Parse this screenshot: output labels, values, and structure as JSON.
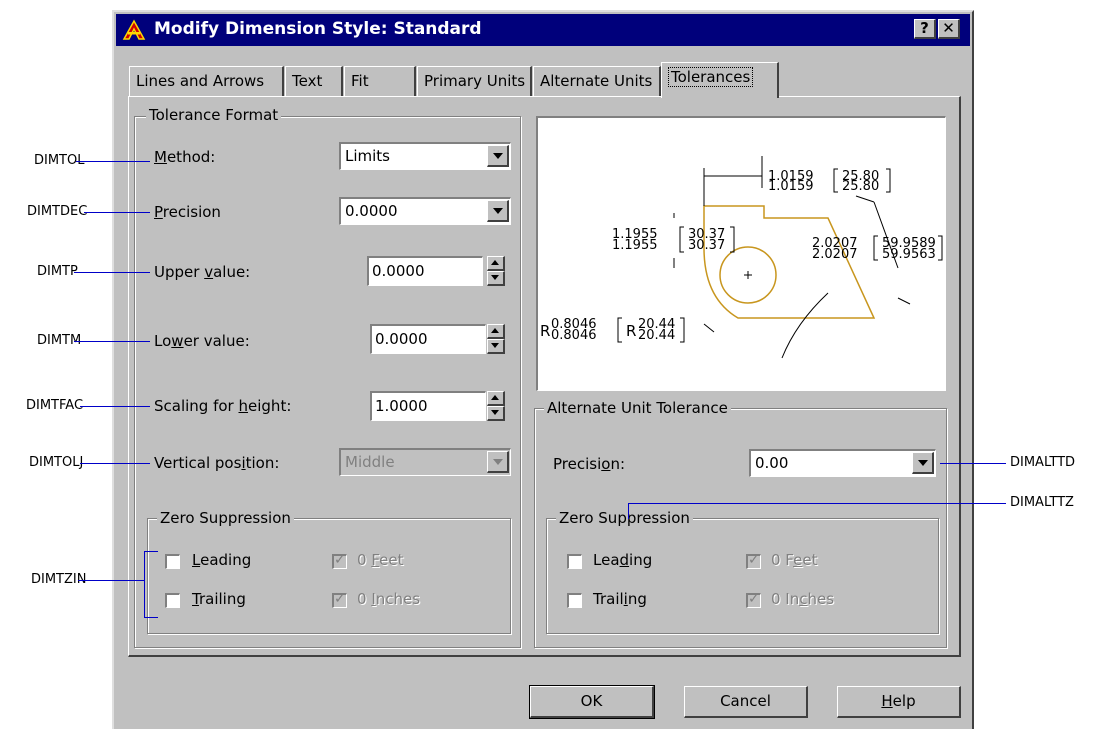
{
  "window": {
    "title": "Modify Dimension Style: Standard",
    "help_btn": "?",
    "close_btn": "✕"
  },
  "tabs": [
    "Lines and Arrows",
    "Text",
    "Fit",
    "Primary Units",
    "Alternate Units",
    "Tolerances"
  ],
  "tolerance_format": {
    "legend": "Tolerance Format",
    "method_label": "Method:",
    "method_value": "Limits",
    "precision_label": "Precision",
    "precision_value": "0.0000",
    "upper_label": "Upper value:",
    "upper_value": "0.0000",
    "lower_label": "Lower value:",
    "lower_value": "0.0000",
    "scaling_label": "Scaling for height:",
    "scaling_value": "1.0000",
    "vertical_label": "Vertical position:",
    "vertical_value": "Middle"
  },
  "zero_suppression_left": {
    "legend": "Zero Suppression",
    "leading": "Leading",
    "trailing": "Trailing",
    "feet": "0 Feet",
    "inches": "0 Inches"
  },
  "alternate_unit_tolerance": {
    "legend": "Alternate Unit Tolerance",
    "precision_label": "Precision:",
    "precision_value": "0.00"
  },
  "zero_suppression_right": {
    "legend": "Zero Suppression",
    "leading": "Leading",
    "trailing": "Trailing",
    "feet": "0 Feet",
    "inches": "0 Inches"
  },
  "buttons": {
    "ok": "OK",
    "cancel": "Cancel",
    "help": "Help"
  },
  "preview": {
    "top_a": "1.0159",
    "top_b": "1.0159",
    "top_c": "25.80",
    "top_d": "25.80",
    "left_a": "1.1955",
    "left_b": "1.1955",
    "left_c": "30.37",
    "left_d": "30.37",
    "right_a": "2.0207",
    "right_b": "2.0207",
    "right_c": "59.9589",
    "right_d": "59.9563",
    "rad_r": "R",
    "rad_a": "0.8046",
    "rad_b": "0.8046",
    "rad_r2": "R",
    "rad_c": "20.44",
    "rad_d": "20.44"
  },
  "callouts": {
    "dimtol": "DIMTOL",
    "dimtdec": "DIMTDEC",
    "dimtp": "DIMTP",
    "dimtm": "DIMTM",
    "dimtfac": "DIMTFAC",
    "dimtolj": "DIMTOLJ",
    "dimtzin": "DIMTZIN",
    "dimalttd": "DIMALTTD",
    "dimalttz": "DIMALTTZ"
  },
  "colors": {
    "titlebar": "#00007b",
    "dialog": "#c0c0c0",
    "callout_line": "#0000c8",
    "preview_shape": "#c8961e"
  }
}
